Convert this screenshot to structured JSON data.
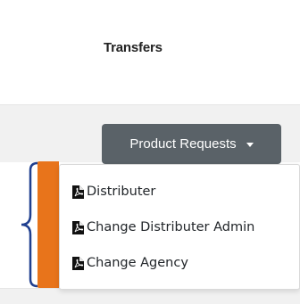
{
  "header": {
    "tab_label": "Transfers"
  },
  "product_requests": {
    "button_label": "Product Requests",
    "caret_icon": "caret-down-icon",
    "items": [
      {
        "label": "Distributer",
        "icon": "pdf-file-icon"
      },
      {
        "label": "Change Distributer Admin",
        "icon": "pdf-file-icon"
      },
      {
        "label": "Change Agency",
        "icon": "pdf-file-icon"
      }
    ]
  },
  "colors": {
    "button_bg": "#5a6268",
    "accent_orange": "#e8741b",
    "bracket_blue": "#1f3f8f",
    "band_gray": "#f1f1f1"
  }
}
